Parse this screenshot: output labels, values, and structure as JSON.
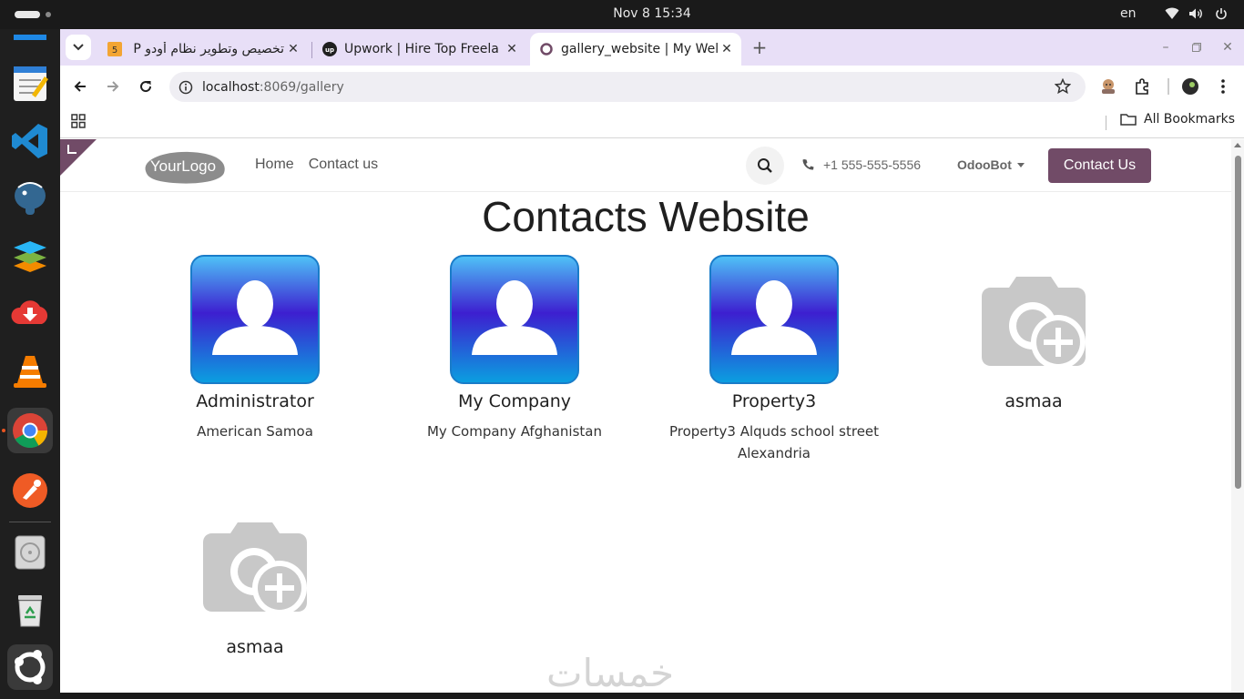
{
  "system": {
    "clock": "Nov 8  15:34",
    "language": "en"
  },
  "browser": {
    "tabs": [
      {
        "title": "تخصيص وتطوير نظام أودو P",
        "favicon": "khamsat-favicon"
      },
      {
        "title": "Upwork | Hire Top Freela",
        "favicon": "upwork-favicon"
      },
      {
        "title": "gallery_website | My Wel",
        "favicon": "odoo-favicon",
        "active": true
      }
    ],
    "url_host": "localhost",
    "url_path": ":8069/gallery",
    "bookmarks_label": "All Bookmarks"
  },
  "site": {
    "logo_text": "YourLogo",
    "nav": [
      "Home",
      "Contact us"
    ],
    "phone": "+1 555-555-5556",
    "user": "OdooBot",
    "cta_label": "Contact Us",
    "page_title": "Contacts Website",
    "brand_color": "#714b67"
  },
  "contacts": [
    {
      "name": "Administrator",
      "address": "American Samoa",
      "image": "person-avatar"
    },
    {
      "name": "My Company",
      "address": "My Company Afghanistan",
      "image": "person-avatar"
    },
    {
      "name": "Property3",
      "address": "Property3 Alquds school street Alexandria",
      "image": "person-avatar"
    },
    {
      "name": "asmaa",
      "address": "",
      "image": "camera-placeholder"
    },
    {
      "name": "asmaa",
      "address": "",
      "image": "camera-placeholder"
    }
  ],
  "watermark": "خمسات"
}
